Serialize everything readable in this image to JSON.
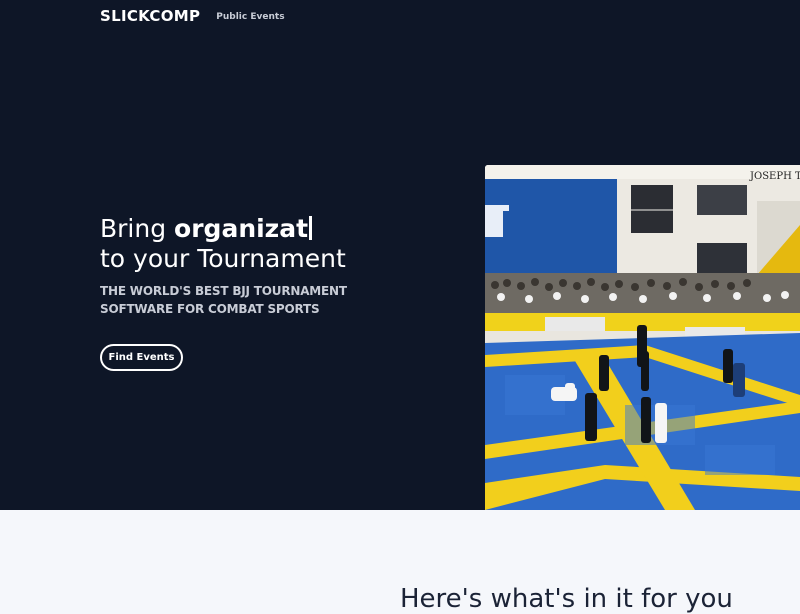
{
  "nav": {
    "logo": "SLICKCOMP",
    "links": [
      "Public Events"
    ]
  },
  "hero": {
    "headline_prefix": "Bring",
    "headline_typed": "organizat",
    "headline_line2": "to your Tournament",
    "subhead": "THE WORLD'S BEST BJJ TOURNAMENT SOFTWARE FOR COMBAT SPORTS",
    "cta_label": "Find Events",
    "photo": {
      "sign_text": "JOSEPH T"
    }
  },
  "section": {
    "title": "Here's what's in it for you"
  },
  "colors": {
    "hero_bg": "#0e1627",
    "page_bg": "#f5f7fb",
    "mat_blue": "#2f6bc8",
    "mat_yellow": "#f2cf1c"
  }
}
